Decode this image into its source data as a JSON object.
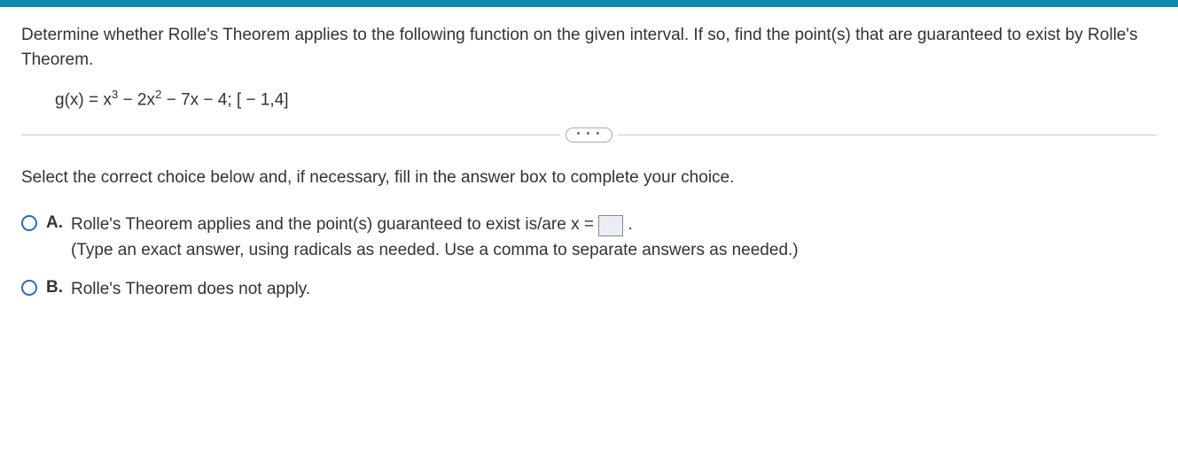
{
  "question": {
    "prompt": "Determine whether Rolle's Theorem applies to the following function on the given interval. If so, find the point(s) that are guaranteed to exist by Rolle's Theorem.",
    "formula_prefix": "g(x) = x",
    "formula_sup1": "3",
    "formula_mid1": " − 2x",
    "formula_sup2": "2",
    "formula_tail": " − 7x − 4; [ − 1,4]"
  },
  "divider_dots": "• • •",
  "instruction": "Select the correct choice below and, if necessary, fill in the answer box to complete your choice.",
  "choices": {
    "a": {
      "letter": "A.",
      "line1_pre": "Rolle's Theorem applies and the point(s) guaranteed to exist is/are x = ",
      "line1_post": " .",
      "hint": "(Type an exact answer, using radicals as needed. Use a comma to separate answers as needed.)",
      "input_value": ""
    },
    "b": {
      "letter": "B.",
      "text": "Rolle's Theorem does not apply."
    }
  }
}
